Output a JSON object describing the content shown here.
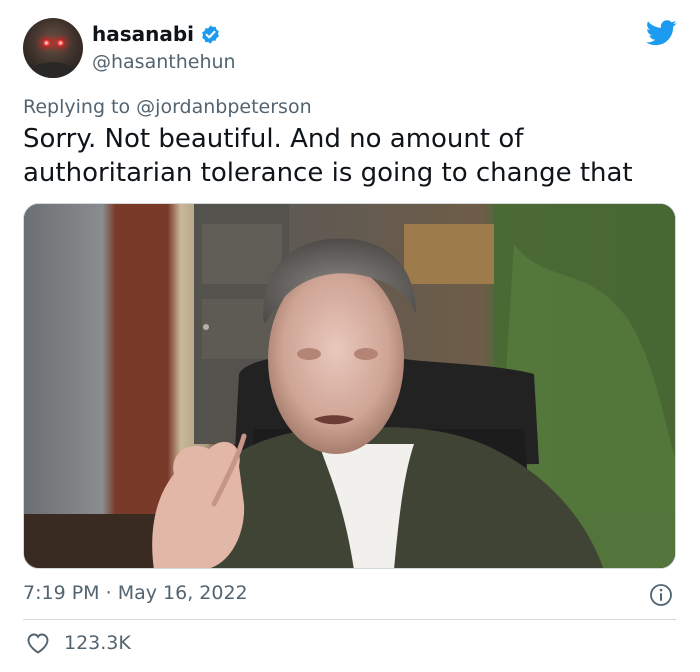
{
  "author": {
    "display_name": "hasanabi",
    "handle": "@hasanthehun",
    "verified": true
  },
  "reply": {
    "prefix": "Replying to",
    "mention": "@jordanbpeterson"
  },
  "tweet": {
    "text": "Sorry. Not beautiful. And no amount of authoritarian tolerance is going to change that"
  },
  "meta": {
    "time": "7:19 PM",
    "separator": "·",
    "date": "May 16, 2022"
  },
  "engagement": {
    "likes": "123.3K"
  },
  "icons": {
    "brand": "twitter-bird-icon",
    "verified": "verified-badge-icon",
    "info": "info-icon",
    "like": "heart-icon"
  },
  "colors": {
    "twitter_blue": "#1d9bf0",
    "text_primary": "#0f1419",
    "text_secondary": "#536471",
    "border": "#cfd9de"
  }
}
